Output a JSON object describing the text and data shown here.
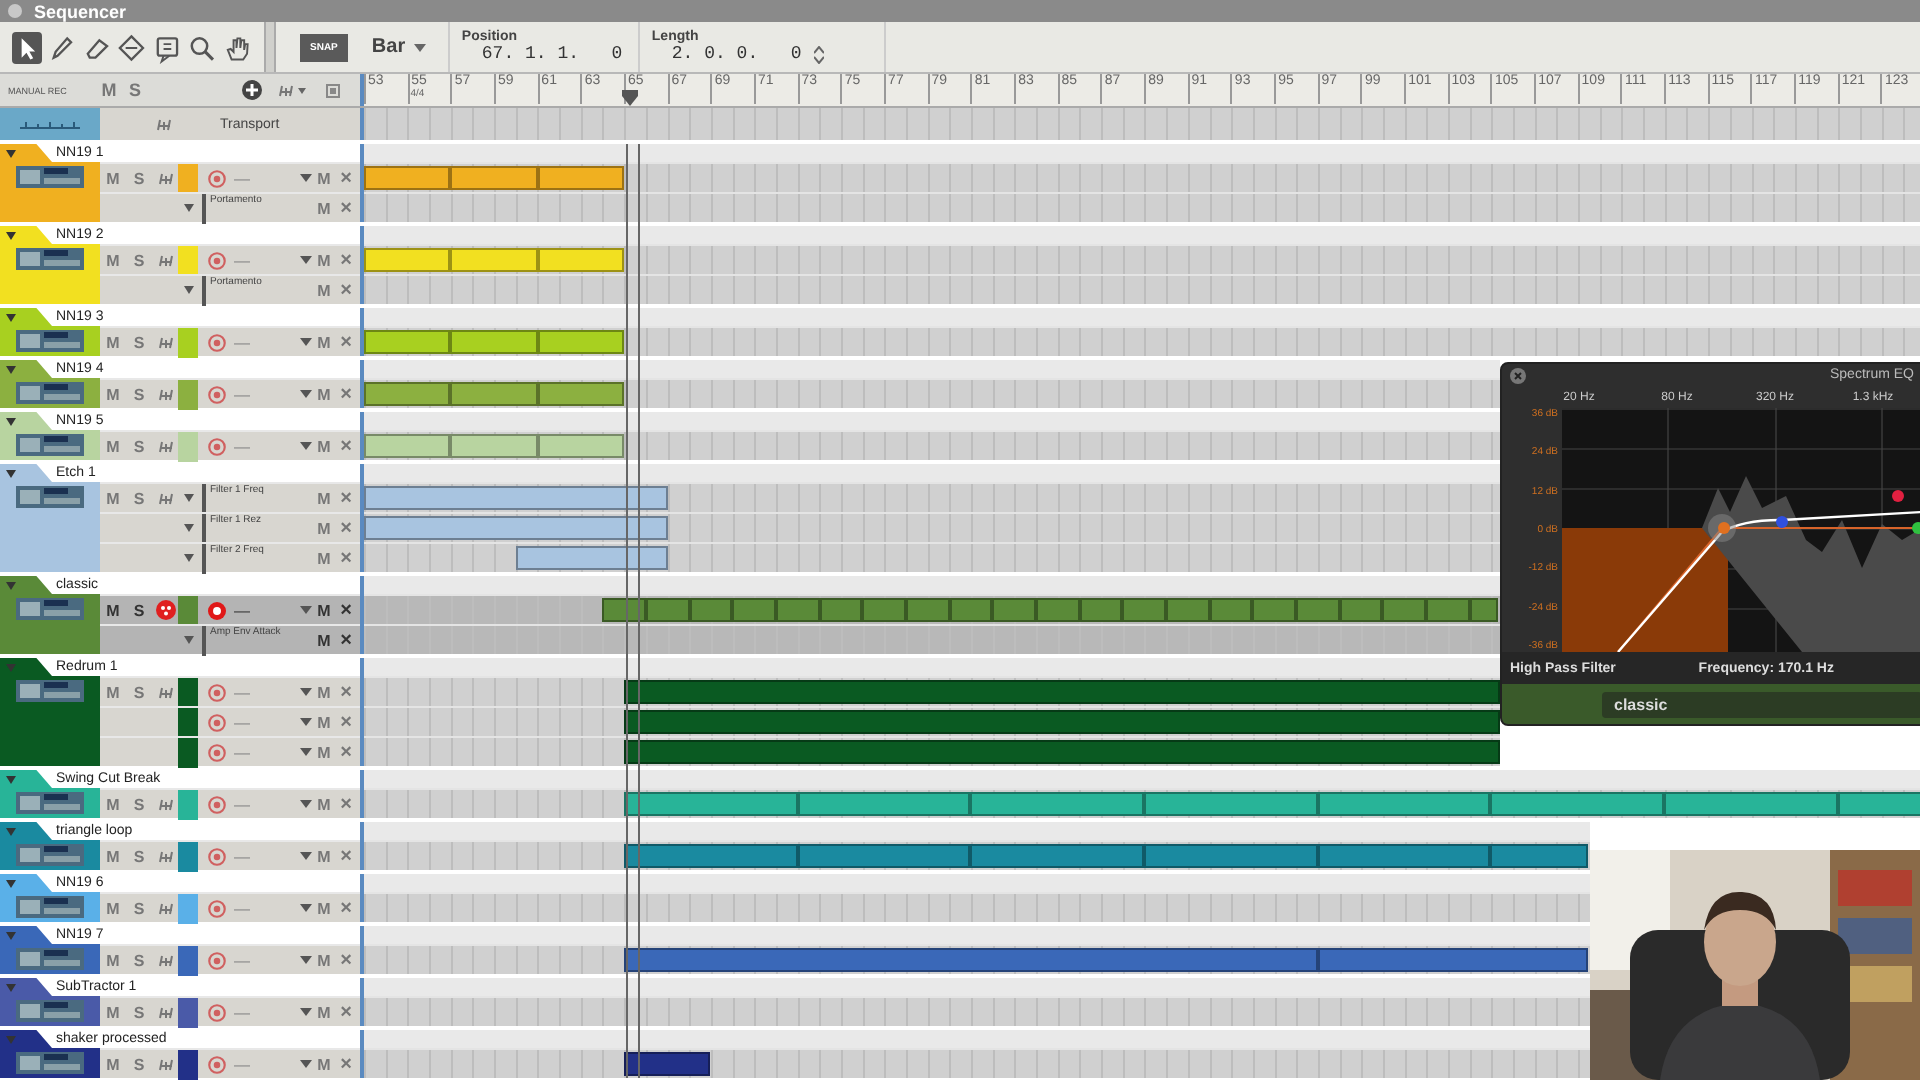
{
  "window": {
    "title": "Sequencer"
  },
  "toolbar": {
    "tools": [
      {
        "kind": "pointer",
        "selected": true
      },
      {
        "kind": "pencil",
        "selected": false
      },
      {
        "kind": "eraser",
        "selected": false
      },
      {
        "kind": "razor",
        "selected": false
      },
      {
        "kind": "mute",
        "selected": false
      },
      {
        "kind": "zoom",
        "selected": false
      },
      {
        "kind": "hand",
        "selected": false
      }
    ],
    "snap": "SNAP",
    "snap_value": "Bar",
    "position": {
      "label": "Position",
      "value": "67. 1. 1.   0"
    },
    "length": {
      "label": "Length",
      "value": "2. 0. 0.   0"
    }
  },
  "header": {
    "manual_rec": "MANUAL REC",
    "mute": "M",
    "solo": "S"
  },
  "ruler": {
    "time_signature": "4/4",
    "labels": [
      "53",
      "55",
      "57",
      "59",
      "61",
      "63",
      "65",
      "67",
      "69",
      "71",
      "73",
      "75",
      "77",
      "79",
      "81",
      "83",
      "85",
      "87",
      "89",
      "91",
      "93",
      "95",
      "97",
      "99",
      "101",
      "103",
      "105",
      "107",
      "109",
      "111",
      "113",
      "115",
      "117",
      "119",
      "121",
      "123"
    ]
  },
  "transport": {
    "label": "Transport"
  },
  "tracks": [
    {
      "name": "NN19 1",
      "color": "#f0b020",
      "selected": false,
      "midi_active": false,
      "mute": "M",
      "solo": "S",
      "lanes": [
        {
          "kind": "note",
          "record_armed": false,
          "dash": "—",
          "mute": "M",
          "delete": "×"
        },
        {
          "kind": "automation",
          "label": "Portamento",
          "mute": "M",
          "delete": "×"
        }
      ]
    },
    {
      "name": "NN19 2",
      "color": "#f2e020",
      "selected": false,
      "midi_active": false,
      "mute": "M",
      "solo": "S",
      "lanes": [
        {
          "kind": "note",
          "record_armed": false,
          "dash": "—",
          "mute": "M",
          "delete": "×"
        },
        {
          "kind": "automation",
          "label": "Portamento",
          "mute": "M",
          "delete": "×"
        }
      ]
    },
    {
      "name": "NN19 3",
      "color": "#a8d020",
      "selected": false,
      "midi_active": false,
      "mute": "M",
      "solo": "S",
      "lanes": [
        {
          "kind": "note",
          "record_armed": false,
          "dash": "—",
          "mute": "M",
          "delete": "×"
        }
      ]
    },
    {
      "name": "NN19 4",
      "color": "#8cb040",
      "selected": false,
      "midi_active": false,
      "mute": "M",
      "solo": "S",
      "lanes": [
        {
          "kind": "note",
          "record_armed": false,
          "dash": "—",
          "mute": "M",
          "delete": "×"
        }
      ]
    },
    {
      "name": "NN19 5",
      "color": "#b8d4a0",
      "selected": false,
      "midi_active": false,
      "mute": "M",
      "solo": "S",
      "lanes": [
        {
          "kind": "note",
          "record_armed": false,
          "dash": "—",
          "mute": "M",
          "delete": "×"
        }
      ]
    },
    {
      "name": "Etch 1",
      "color": "#a8c4e0",
      "selected": false,
      "midi_active": false,
      "mute": "M",
      "solo": "S",
      "lanes": [
        {
          "kind": "automation",
          "label": "Filter 1 Freq",
          "mute": "M",
          "delete": "×"
        },
        {
          "kind": "automation",
          "label": "Filter 1 Rez",
          "mute": "M",
          "delete": "×"
        },
        {
          "kind": "automation",
          "label": "Filter 2 Freq",
          "mute": "M",
          "delete": "×"
        }
      ]
    },
    {
      "name": "classic",
      "color": "#5a8a38",
      "selected": true,
      "midi_active": true,
      "mute": "M",
      "solo": "S",
      "lanes": [
        {
          "kind": "note",
          "record_armed": true,
          "dash": "—",
          "mute": "M",
          "delete": "×"
        },
        {
          "kind": "automation",
          "label": "Amp Env Attack",
          "mute": "M",
          "delete": "×"
        }
      ]
    },
    {
      "name": "Redrum 1",
      "color": "#0a5a22",
      "selected": false,
      "midi_active": false,
      "mute": "M",
      "solo": "S",
      "lanes": [
        {
          "kind": "note",
          "record_armed": false,
          "dash": "—",
          "mute": "M",
          "delete": "×"
        },
        {
          "kind": "note",
          "record_armed": false,
          "dash": "—",
          "mute": "M",
          "delete": "×"
        },
        {
          "kind": "note",
          "record_armed": false,
          "dash": "—",
          "mute": "M",
          "delete": "×"
        }
      ]
    },
    {
      "name": "Swing Cut Break",
      "color": "#28b498",
      "selected": false,
      "midi_active": false,
      "mute": "M",
      "solo": "S",
      "lanes": [
        {
          "kind": "note",
          "record_armed": false,
          "dash": "—",
          "mute": "M",
          "delete": "×"
        }
      ]
    },
    {
      "name": "triangle loop",
      "color": "#1a8aa0",
      "selected": false,
      "midi_active": false,
      "mute": "M",
      "solo": "S",
      "lanes": [
        {
          "kind": "note",
          "record_armed": false,
          "dash": "—",
          "mute": "M",
          "delete": "×"
        }
      ]
    },
    {
      "name": "NN19 6",
      "color": "#5ab0e8",
      "selected": false,
      "midi_active": false,
      "mute": "M",
      "solo": "S",
      "lanes": [
        {
          "kind": "note",
          "record_armed": false,
          "dash": "—",
          "mute": "M",
          "delete": "×"
        }
      ]
    },
    {
      "name": "NN19 7",
      "color": "#3a68b8",
      "selected": false,
      "midi_active": false,
      "mute": "M",
      "solo": "S",
      "lanes": [
        {
          "kind": "note",
          "record_armed": false,
          "dash": "—",
          "mute": "M",
          "delete": "×"
        }
      ]
    },
    {
      "name": "SubTractor 1",
      "color": "#4a5aa8",
      "selected": false,
      "midi_active": false,
      "mute": "M",
      "solo": "S",
      "lanes": [
        {
          "kind": "note",
          "record_armed": false,
          "dash": "—",
          "mute": "M",
          "delete": "×"
        }
      ]
    },
    {
      "name": "shaker processed",
      "color": "#223088",
      "selected": false,
      "midi_active": false,
      "mute": "M",
      "solo": "S",
      "lanes": [
        {
          "kind": "note",
          "record_armed": false,
          "dash": "—",
          "mute": "M",
          "delete": "×"
        }
      ]
    }
  ],
  "eq_panel": {
    "title": "Spectrum EQ",
    "freq_labels": [
      "20 Hz",
      "80 Hz",
      "320 Hz",
      "1.3 kHz"
    ],
    "db_labels": [
      "36 dB",
      "24 dB",
      "12 dB",
      "0 dB",
      "-12 dB",
      "-24 dB",
      "-36 dB"
    ],
    "filter": "High Pass Filter",
    "frequency": "Frequency: 170.1 Hz",
    "device": "classic"
  }
}
